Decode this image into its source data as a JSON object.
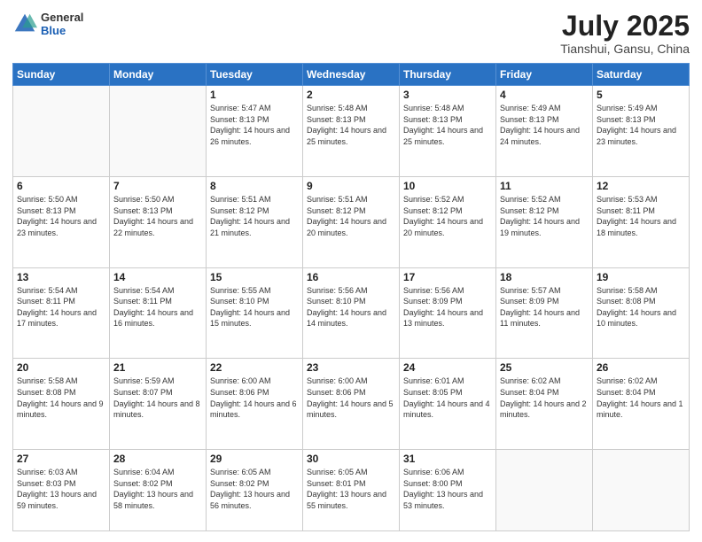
{
  "header": {
    "logo": {
      "general": "General",
      "blue": "Blue"
    },
    "title": "July 2025",
    "location": "Tianshui, Gansu, China"
  },
  "days_of_week": [
    "Sunday",
    "Monday",
    "Tuesday",
    "Wednesday",
    "Thursday",
    "Friday",
    "Saturday"
  ],
  "weeks": [
    [
      {
        "day": "",
        "sunrise": "",
        "sunset": "",
        "daylight": ""
      },
      {
        "day": "",
        "sunrise": "",
        "sunset": "",
        "daylight": ""
      },
      {
        "day": "1",
        "sunrise": "Sunrise: 5:47 AM",
        "sunset": "Sunset: 8:13 PM",
        "daylight": "Daylight: 14 hours and 26 minutes."
      },
      {
        "day": "2",
        "sunrise": "Sunrise: 5:48 AM",
        "sunset": "Sunset: 8:13 PM",
        "daylight": "Daylight: 14 hours and 25 minutes."
      },
      {
        "day": "3",
        "sunrise": "Sunrise: 5:48 AM",
        "sunset": "Sunset: 8:13 PM",
        "daylight": "Daylight: 14 hours and 25 minutes."
      },
      {
        "day": "4",
        "sunrise": "Sunrise: 5:49 AM",
        "sunset": "Sunset: 8:13 PM",
        "daylight": "Daylight: 14 hours and 24 minutes."
      },
      {
        "day": "5",
        "sunrise": "Sunrise: 5:49 AM",
        "sunset": "Sunset: 8:13 PM",
        "daylight": "Daylight: 14 hours and 23 minutes."
      }
    ],
    [
      {
        "day": "6",
        "sunrise": "Sunrise: 5:50 AM",
        "sunset": "Sunset: 8:13 PM",
        "daylight": "Daylight: 14 hours and 23 minutes."
      },
      {
        "day": "7",
        "sunrise": "Sunrise: 5:50 AM",
        "sunset": "Sunset: 8:13 PM",
        "daylight": "Daylight: 14 hours and 22 minutes."
      },
      {
        "day": "8",
        "sunrise": "Sunrise: 5:51 AM",
        "sunset": "Sunset: 8:12 PM",
        "daylight": "Daylight: 14 hours and 21 minutes."
      },
      {
        "day": "9",
        "sunrise": "Sunrise: 5:51 AM",
        "sunset": "Sunset: 8:12 PM",
        "daylight": "Daylight: 14 hours and 20 minutes."
      },
      {
        "day": "10",
        "sunrise": "Sunrise: 5:52 AM",
        "sunset": "Sunset: 8:12 PM",
        "daylight": "Daylight: 14 hours and 20 minutes."
      },
      {
        "day": "11",
        "sunrise": "Sunrise: 5:52 AM",
        "sunset": "Sunset: 8:12 PM",
        "daylight": "Daylight: 14 hours and 19 minutes."
      },
      {
        "day": "12",
        "sunrise": "Sunrise: 5:53 AM",
        "sunset": "Sunset: 8:11 PM",
        "daylight": "Daylight: 14 hours and 18 minutes."
      }
    ],
    [
      {
        "day": "13",
        "sunrise": "Sunrise: 5:54 AM",
        "sunset": "Sunset: 8:11 PM",
        "daylight": "Daylight: 14 hours and 17 minutes."
      },
      {
        "day": "14",
        "sunrise": "Sunrise: 5:54 AM",
        "sunset": "Sunset: 8:11 PM",
        "daylight": "Daylight: 14 hours and 16 minutes."
      },
      {
        "day": "15",
        "sunrise": "Sunrise: 5:55 AM",
        "sunset": "Sunset: 8:10 PM",
        "daylight": "Daylight: 14 hours and 15 minutes."
      },
      {
        "day": "16",
        "sunrise": "Sunrise: 5:56 AM",
        "sunset": "Sunset: 8:10 PM",
        "daylight": "Daylight: 14 hours and 14 minutes."
      },
      {
        "day": "17",
        "sunrise": "Sunrise: 5:56 AM",
        "sunset": "Sunset: 8:09 PM",
        "daylight": "Daylight: 14 hours and 13 minutes."
      },
      {
        "day": "18",
        "sunrise": "Sunrise: 5:57 AM",
        "sunset": "Sunset: 8:09 PM",
        "daylight": "Daylight: 14 hours and 11 minutes."
      },
      {
        "day": "19",
        "sunrise": "Sunrise: 5:58 AM",
        "sunset": "Sunset: 8:08 PM",
        "daylight": "Daylight: 14 hours and 10 minutes."
      }
    ],
    [
      {
        "day": "20",
        "sunrise": "Sunrise: 5:58 AM",
        "sunset": "Sunset: 8:08 PM",
        "daylight": "Daylight: 14 hours and 9 minutes."
      },
      {
        "day": "21",
        "sunrise": "Sunrise: 5:59 AM",
        "sunset": "Sunset: 8:07 PM",
        "daylight": "Daylight: 14 hours and 8 minutes."
      },
      {
        "day": "22",
        "sunrise": "Sunrise: 6:00 AM",
        "sunset": "Sunset: 8:06 PM",
        "daylight": "Daylight: 14 hours and 6 minutes."
      },
      {
        "day": "23",
        "sunrise": "Sunrise: 6:00 AM",
        "sunset": "Sunset: 8:06 PM",
        "daylight": "Daylight: 14 hours and 5 minutes."
      },
      {
        "day": "24",
        "sunrise": "Sunrise: 6:01 AM",
        "sunset": "Sunset: 8:05 PM",
        "daylight": "Daylight: 14 hours and 4 minutes."
      },
      {
        "day": "25",
        "sunrise": "Sunrise: 6:02 AM",
        "sunset": "Sunset: 8:04 PM",
        "daylight": "Daylight: 14 hours and 2 minutes."
      },
      {
        "day": "26",
        "sunrise": "Sunrise: 6:02 AM",
        "sunset": "Sunset: 8:04 PM",
        "daylight": "Daylight: 14 hours and 1 minute."
      }
    ],
    [
      {
        "day": "27",
        "sunrise": "Sunrise: 6:03 AM",
        "sunset": "Sunset: 8:03 PM",
        "daylight": "Daylight: 13 hours and 59 minutes."
      },
      {
        "day": "28",
        "sunrise": "Sunrise: 6:04 AM",
        "sunset": "Sunset: 8:02 PM",
        "daylight": "Daylight: 13 hours and 58 minutes."
      },
      {
        "day": "29",
        "sunrise": "Sunrise: 6:05 AM",
        "sunset": "Sunset: 8:02 PM",
        "daylight": "Daylight: 13 hours and 56 minutes."
      },
      {
        "day": "30",
        "sunrise": "Sunrise: 6:05 AM",
        "sunset": "Sunset: 8:01 PM",
        "daylight": "Daylight: 13 hours and 55 minutes."
      },
      {
        "day": "31",
        "sunrise": "Sunrise: 6:06 AM",
        "sunset": "Sunset: 8:00 PM",
        "daylight": "Daylight: 13 hours and 53 minutes."
      },
      {
        "day": "",
        "sunrise": "",
        "sunset": "",
        "daylight": ""
      },
      {
        "day": "",
        "sunrise": "",
        "sunset": "",
        "daylight": ""
      }
    ]
  ]
}
